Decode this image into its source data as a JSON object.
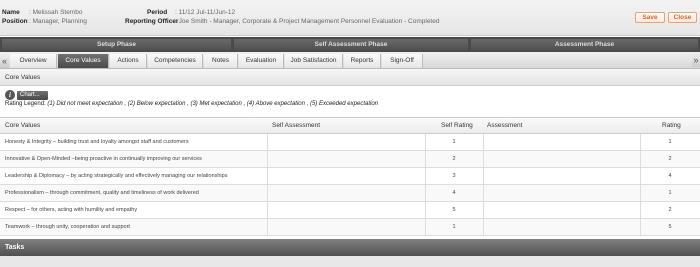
{
  "header": {
    "name_label": "Name",
    "name_value": ": Melissah Stembo",
    "position_label": "Position",
    "position_value": ": Manager, Planning",
    "period_label": "Period",
    "period_value": ": 11/12 Jul-11/Jun-12",
    "officer_label": "Reporting Officer",
    "officer_value": ": Joe Smith - Manager, Corporate & Project Management Personnel Evaluation - Completed",
    "save_label": "Save",
    "close_label": "Close"
  },
  "phases": [
    "Setup Phase",
    "Self Assessment Phase",
    "Assessment Phase"
  ],
  "tabs": [
    "Overview",
    "Core Values",
    "Actions",
    "Competencies",
    "Notes",
    "Evaluation",
    "Job Satisfaction",
    "Reports",
    "Sign-Off"
  ],
  "active_tab": "Core Values",
  "section": {
    "title": "Core Values",
    "chart_button": "Chart...",
    "legend_label": "Rating Legend:",
    "legend_text": "(1) Did not meet expectation , (2) Below expectation , (3) Met expectation , (4) Above expectation , (5) Exceeded expectation"
  },
  "table": {
    "columns": [
      "Core Values",
      "Self Assessment",
      "Self Rating",
      "Assessment",
      "Rating"
    ],
    "rows": [
      {
        "value": "Honesty & Integrity – building trust and loyalty amongst staff and customers",
        "self_assessment": "",
        "self_rating": "1",
        "assessment": "",
        "rating": "1"
      },
      {
        "value": "Innovative & Open-Minded –being proactive in continually improving our services",
        "self_assessment": "",
        "self_rating": "2",
        "assessment": "",
        "rating": "2"
      },
      {
        "value": "Leadership & Diplomacy – by acting strategically and effectively managing our relationships",
        "self_assessment": "",
        "self_rating": "3",
        "assessment": "",
        "rating": "4"
      },
      {
        "value": "Professionalism – through commitment, quality and timeliness of work delivered",
        "self_assessment": "",
        "self_rating": "4",
        "assessment": "",
        "rating": "1"
      },
      {
        "value": "Respect – for others, acting with humility and empathy",
        "self_assessment": "",
        "self_rating": "5",
        "assessment": "",
        "rating": "2"
      },
      {
        "value": "Teamwork – through unity, cooperation and support",
        "self_assessment": "",
        "self_rating": "1",
        "assessment": "",
        "rating": "5"
      }
    ]
  },
  "tasks_label": "Tasks",
  "colors": {
    "accent": "#e06020",
    "dark_bar": "#4a4a4a"
  },
  "icons": {
    "info": "info-icon",
    "scroll_left": "chevron-left-icon",
    "scroll_right": "chevron-right-icon"
  }
}
